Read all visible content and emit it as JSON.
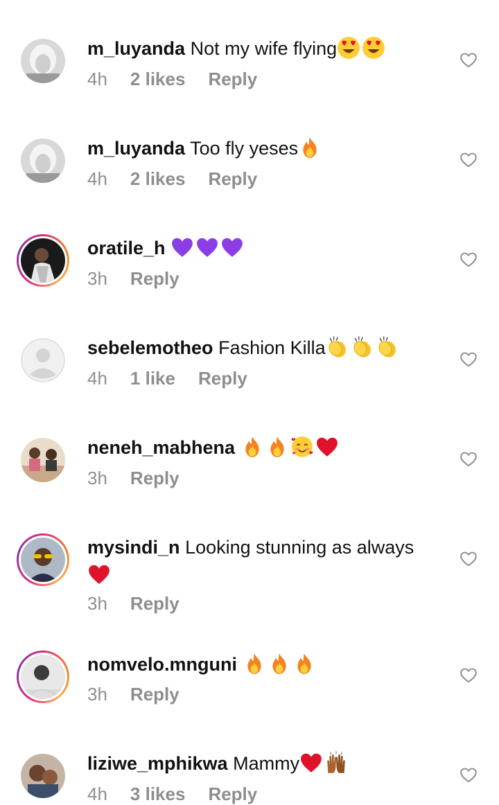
{
  "comments": [
    {
      "username": "m_luyanda",
      "text": "Not my wife flying",
      "time": "4h",
      "likes": "2 likes",
      "reply": "Reply"
    },
    {
      "username": "m_luyanda",
      "text": "Too fly yeses",
      "time": "4h",
      "likes": "2 likes",
      "reply": "Reply"
    },
    {
      "username": "oratile_h",
      "text": "",
      "time": "3h",
      "likes": "",
      "reply": "Reply"
    },
    {
      "username": "sebelemotheo",
      "text": "Fashion Killa",
      "time": "4h",
      "likes": "1 like",
      "reply": "Reply"
    },
    {
      "username": "neneh_mabhena",
      "text": "",
      "time": "3h",
      "likes": "",
      "reply": "Reply"
    },
    {
      "username": "mysindi_n",
      "text": "Looking stunning as always",
      "time": "3h",
      "likes": "",
      "reply": "Reply"
    },
    {
      "username": "nomvelo.mnguni",
      "text": "",
      "time": "3h",
      "likes": "",
      "reply": "Reply"
    },
    {
      "username": "liziwe_mphikwa",
      "text": "Mammy",
      "time": "4h",
      "likes": "3 likes",
      "reply": "Reply"
    }
  ],
  "emoji_names": {
    "c0": [
      "heart-eyes-emoji",
      "heart-eyes-emoji"
    ],
    "c1": [
      "fire-emoji"
    ],
    "c2": [
      "purple-heart-emoji",
      "purple-heart-emoji",
      "purple-heart-emoji"
    ],
    "c3": [
      "clapping-hands-emoji",
      "clapping-hands-emoji",
      "clapping-hands-emoji"
    ],
    "c4": [
      "fire-emoji",
      "fire-emoji",
      "smiling-face-with-hearts-emoji",
      "red-heart-emoji"
    ],
    "c5": [
      "red-heart-emoji"
    ],
    "c6": [
      "fire-emoji",
      "fire-emoji",
      "fire-emoji"
    ],
    "c7": [
      "red-heart-emoji",
      "raising-hands-emoji"
    ]
  },
  "colors": {
    "meta_gray": "#8e8e8e",
    "purple": "#8b3ee6",
    "red": "#e0122b",
    "fire_orange": "#f7811e",
    "clap_yellow": "#f9c021"
  }
}
